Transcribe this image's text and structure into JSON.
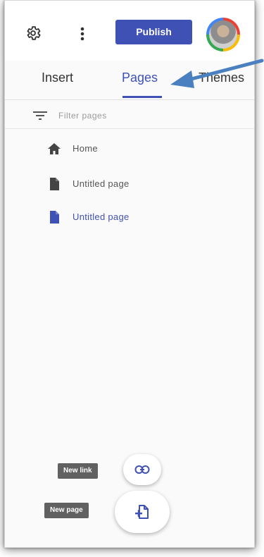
{
  "topbar": {
    "publish_label": "Publish",
    "settings_icon": "gear-icon",
    "more_icon": "vertical-dots-icon"
  },
  "tabs": [
    {
      "label": "Insert",
      "active": false
    },
    {
      "label": "Pages",
      "active": true
    },
    {
      "label": "Themes",
      "active": false
    }
  ],
  "filter": {
    "placeholder": "Filter pages"
  },
  "pages": [
    {
      "label": "Home",
      "icon": "home-icon",
      "active": false
    },
    {
      "label": "Untitled page",
      "icon": "page-icon",
      "active": false
    },
    {
      "label": "Untitled page",
      "icon": "page-icon",
      "active": true
    }
  ],
  "actions": {
    "new_link_tooltip": "New link",
    "new_page_tooltip": "New page"
  },
  "colors": {
    "accent": "#3f51b5",
    "tooltip_bg": "#616161",
    "annotation_arrow": "#4a7fc0"
  }
}
